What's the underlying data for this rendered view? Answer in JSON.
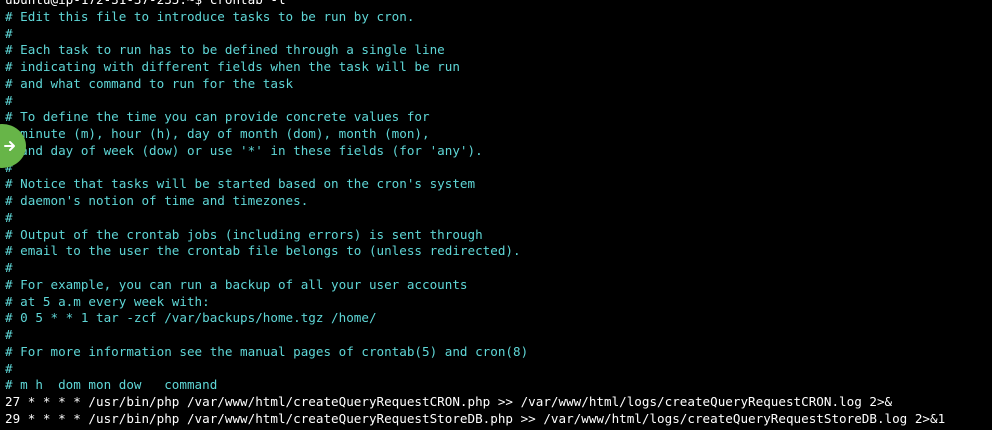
{
  "terminal": {
    "prompt_line": "ubuntu@ip-172-31-37-235:~$ crontab -l",
    "comment_lines": [
      "# Edit this file to introduce tasks to be run by cron.",
      "#",
      "# Each task to run has to be defined through a single line",
      "# indicating with different fields when the task will be run",
      "# and what command to run for the task",
      "#",
      "# To define the time you can provide concrete values for",
      "# minute (m), hour (h), day of month (dom), month (mon),",
      "# and day of week (dow) or use '*' in these fields (for 'any').",
      "#",
      "# Notice that tasks will be started based on the cron's system",
      "# daemon's notion of time and timezones.",
      "#",
      "# Output of the crontab jobs (including errors) is sent through",
      "# email to the user the crontab file belongs to (unless redirected).",
      "#",
      "# For example, you can run a backup of all your user accounts",
      "# at 5 a.m every week with:",
      "# 0 5 * * 1 tar -zcf /var/backups/home.tgz /home/",
      "#",
      "# For more information see the manual pages of crontab(5) and cron(8)",
      "#",
      "# m h  dom mon dow   command"
    ],
    "job_lines": [
      "27 * * * * /usr/bin/php /var/www/html/createQueryRequestCRON.php >> /var/www/html/logs/createQueryRequestCRON.log 2>&",
      "29 * * * * /usr/bin/php /var/www/html/createQueryRequestStoreDB.php >> /var/www/html/logs/createQueryRequestStoreDB.log 2>&1"
    ]
  },
  "colors": {
    "background": "#000000",
    "comment_text": "#5fd7d7",
    "command_text": "#ffffff",
    "badge": "#67b548"
  },
  "overlay": {
    "icon": "arrow-right-icon"
  }
}
